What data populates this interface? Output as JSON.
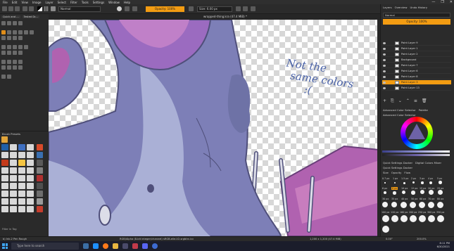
{
  "menu": [
    "File",
    "Edit",
    "View",
    "Image",
    "Layer",
    "Select",
    "Filter",
    "Tools",
    "Settings",
    "Window",
    "Help"
  ],
  "window_controls": [
    "—",
    "❐",
    "✕"
  ],
  "toolbar": {
    "blend_mode": "Normal",
    "opacity_label": "Opacity: 100%",
    "size_label": "Size: 6.00 px"
  },
  "doc_tabs": [
    "Quick and ...",
    "Tested Dr..."
  ],
  "canvas": {
    "title": "wrapped-thing.kra (47.4 MiB) *",
    "note_line1": "Not the",
    "note_line2": "same colors",
    "note_face": ":("
  },
  "brush_docker": {
    "title": "Brush Presets",
    "filter_label": "Filter in Tag"
  },
  "right_panel": {
    "tabs": [
      "Layers",
      "Overview",
      "Undo History"
    ],
    "blend_mode": "Normal",
    "opacity_label": "Opacity: 100%",
    "layers": [
      {
        "name": "Paint Layer 9",
        "selected": false
      },
      {
        "name": "Paint Layer 1",
        "selected": false
      },
      {
        "name": "Paint Layer 2",
        "selected": false
      },
      {
        "name": "Background",
        "selected": false
      },
      {
        "name": "Paint Layer 7",
        "selected": false
      },
      {
        "name": "Paint Layer 6",
        "selected": false
      },
      {
        "name": "Paint Layer 8",
        "selected": false
      },
      {
        "name": "Paint Layer 3",
        "selected": true
      },
      {
        "name": "Paint Layer 13",
        "selected": false
      }
    ],
    "color_tabs": [
      "Advanced Color Selector",
      "Palette"
    ],
    "color_header": "Advanced Color Selector",
    "quick_tabs": [
      "Quick Settings Docker",
      "Digital Colors Mixer"
    ],
    "quick_header": "Quick Settings Docker",
    "quick_subtabs": [
      "Size",
      "Opacity",
      "Flow"
    ],
    "sizes_row1": [
      "0.7 px",
      "1 px",
      "1.5 px",
      "2 px",
      "3 px",
      "4 px",
      "5 px"
    ],
    "sizes_row2": [
      "6 px",
      "8 px",
      "10 px",
      "12 px",
      "15 px",
      "20 px",
      "25 px"
    ],
    "sizes_row3": [
      "30 px",
      "35 px",
      "40 px",
      "50 px",
      "60 px",
      "70 px",
      "80 px"
    ],
    "sizes_row4": [
      "100 px",
      "120 px",
      "160 px",
      "200 px",
      "250 px",
      "300 px",
      "350 px"
    ],
    "selected_size": "6 px"
  },
  "statusbar": {
    "left": "b) Ink-2 Pen Rough",
    "middle": "RGB/Alpha (8-bit integer/channel) sRGB-elle-V2-srgbtrc.icc",
    "dims": "1,200 x 1,200 (47.4 MiB)",
    "angle": "0.00°",
    "zoom": "200.0%"
  },
  "taskbar": {
    "search_placeholder": "Type here to search",
    "time": "8:11 PM",
    "date": "6/30/2021"
  },
  "colors": {
    "accent": "#f39c12",
    "dragon_body": "#7d7fb7",
    "dragon_light": "#aab0d6",
    "wing_pink": "#b062b0",
    "note_blue": "#4b63a8"
  }
}
